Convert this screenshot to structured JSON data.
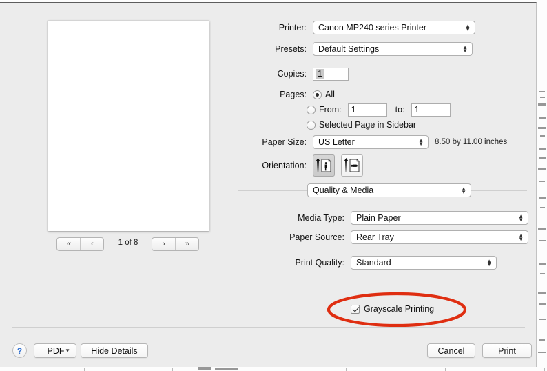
{
  "dialog": {
    "preview": {
      "nav": {
        "first_label": "«",
        "prev_label": "‹",
        "next_label": "›",
        "last_label": "»",
        "page_status": "1 of 8"
      }
    },
    "settings": {
      "printer": {
        "label": "Printer:",
        "value": "Canon MP240 series Printer"
      },
      "presets": {
        "label": "Presets:",
        "value": "Default Settings"
      },
      "copies": {
        "label": "Copies:",
        "value": "1"
      },
      "pages": {
        "label": "Pages:",
        "all_label": "All",
        "all_selected": true,
        "from_label": "From:",
        "from_value": "1",
        "to_label": "to:",
        "to_value": "1",
        "selected_page_label": "Selected Page in Sidebar"
      },
      "paper_size": {
        "label": "Paper Size:",
        "value": "US Letter",
        "dimensions": "8.50 by 11.00 inches"
      },
      "orientation": {
        "label": "Orientation:",
        "portrait_name": "portrait-orientation",
        "landscape_name": "landscape-orientation",
        "selected": "portrait"
      },
      "pane_selector": {
        "value": "Quality & Media"
      },
      "media_type": {
        "label": "Media Type:",
        "value": "Plain Paper"
      },
      "paper_source": {
        "label": "Paper Source:",
        "value": "Rear Tray"
      },
      "print_quality": {
        "label": "Print Quality:",
        "value": "Standard"
      },
      "grayscale": {
        "label": "Grayscale Printing",
        "checked": true
      }
    },
    "footer": {
      "help_label": "?",
      "pdf_label": "PDF",
      "hide_details_label": "Hide Details",
      "cancel_label": "Cancel",
      "print_label": "Print"
    },
    "annotation": {
      "color": "#DF2E11",
      "shape": "ellipse",
      "target": "Grayscale Printing"
    },
    "colors": {
      "sheet_background": "#ECECEC",
      "control_background": "#FFFFFF",
      "text": "#111111",
      "annotation_red": "#DF2E11",
      "help_blue": "#2F6FD0"
    }
  }
}
